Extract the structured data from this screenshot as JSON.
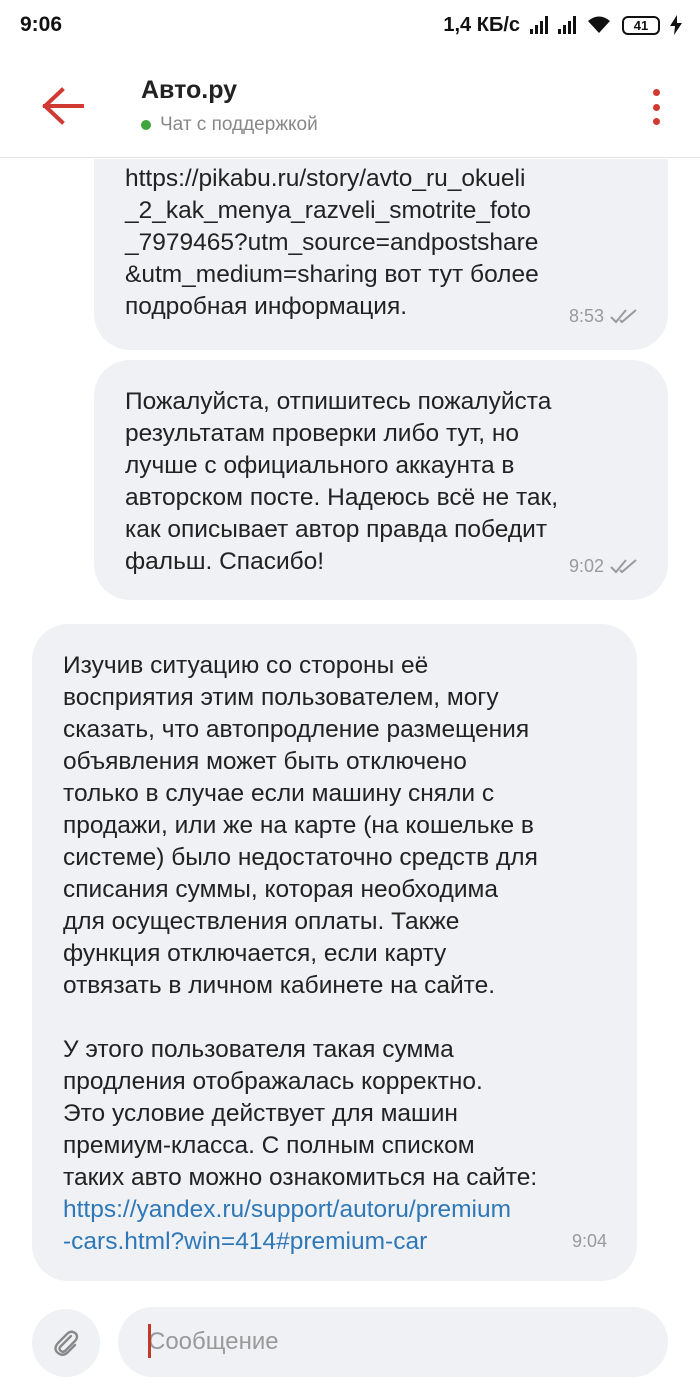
{
  "status_bar": {
    "time": "9:06",
    "speed": "1,4 КБ/с",
    "battery": "41"
  },
  "header": {
    "title": "Авто.ру",
    "subtitle": "Чат с поддержкой",
    "accent_color": "#d03a32",
    "online_color": "#3fa53a"
  },
  "messages": [
    {
      "direction": "outgoing",
      "text": "https://pikabu.ru/story/avto_ru_okueli\n_2_kak_menya_razveli_smotrite_foto\n_7979465?utm_source=andpostshare\n&utm_medium=sharing вот тут более\nподробная информация.",
      "time": "8:53",
      "read": true
    },
    {
      "direction": "outgoing",
      "text": "Пожалуйста, отпишитесь пожалуйста\nрезультатам проверки либо тут,  но\nлучше с официального аккаунта в\nавторском посте.  Надеюсь всё не так,\nкак описывает автор правда победит\nфальш.  Спасибо!",
      "time": "9:02",
      "read": true
    },
    {
      "direction": "incoming",
      "text": "Изучив ситуацию со стороны её\nвосприятия этим пользователем, могу\nсказать, что автопродление размещения\nобъявления может быть отключено\nтолько в случае если машину сняли с\nпродажи, или же на карте (на кошельке в\nсистеме) было недостаточно средств для\nсписания суммы, которая необходима\nдля осуществления оплаты. Также\nфункция отключается, если карту\nотвязать в личном кабинете на сайте.\n\nУ этого пользователя такая сумма\nпродления отображалась корректно.\nЭто условие действует для машин\nпремиум-класса. С полным списком\nтаких авто можно ознакомиться на сайте:",
      "link": "https://yandex.ru/support/autoru/premium\n-cars.html?win=414#premium-car",
      "time": "9:04"
    }
  ],
  "composer": {
    "placeholder": "Сообщение"
  },
  "icons": {
    "back": "arrow-left-icon",
    "menu": "more-vertical-icon",
    "attach": "paperclip-icon",
    "read": "double-check-icon"
  }
}
